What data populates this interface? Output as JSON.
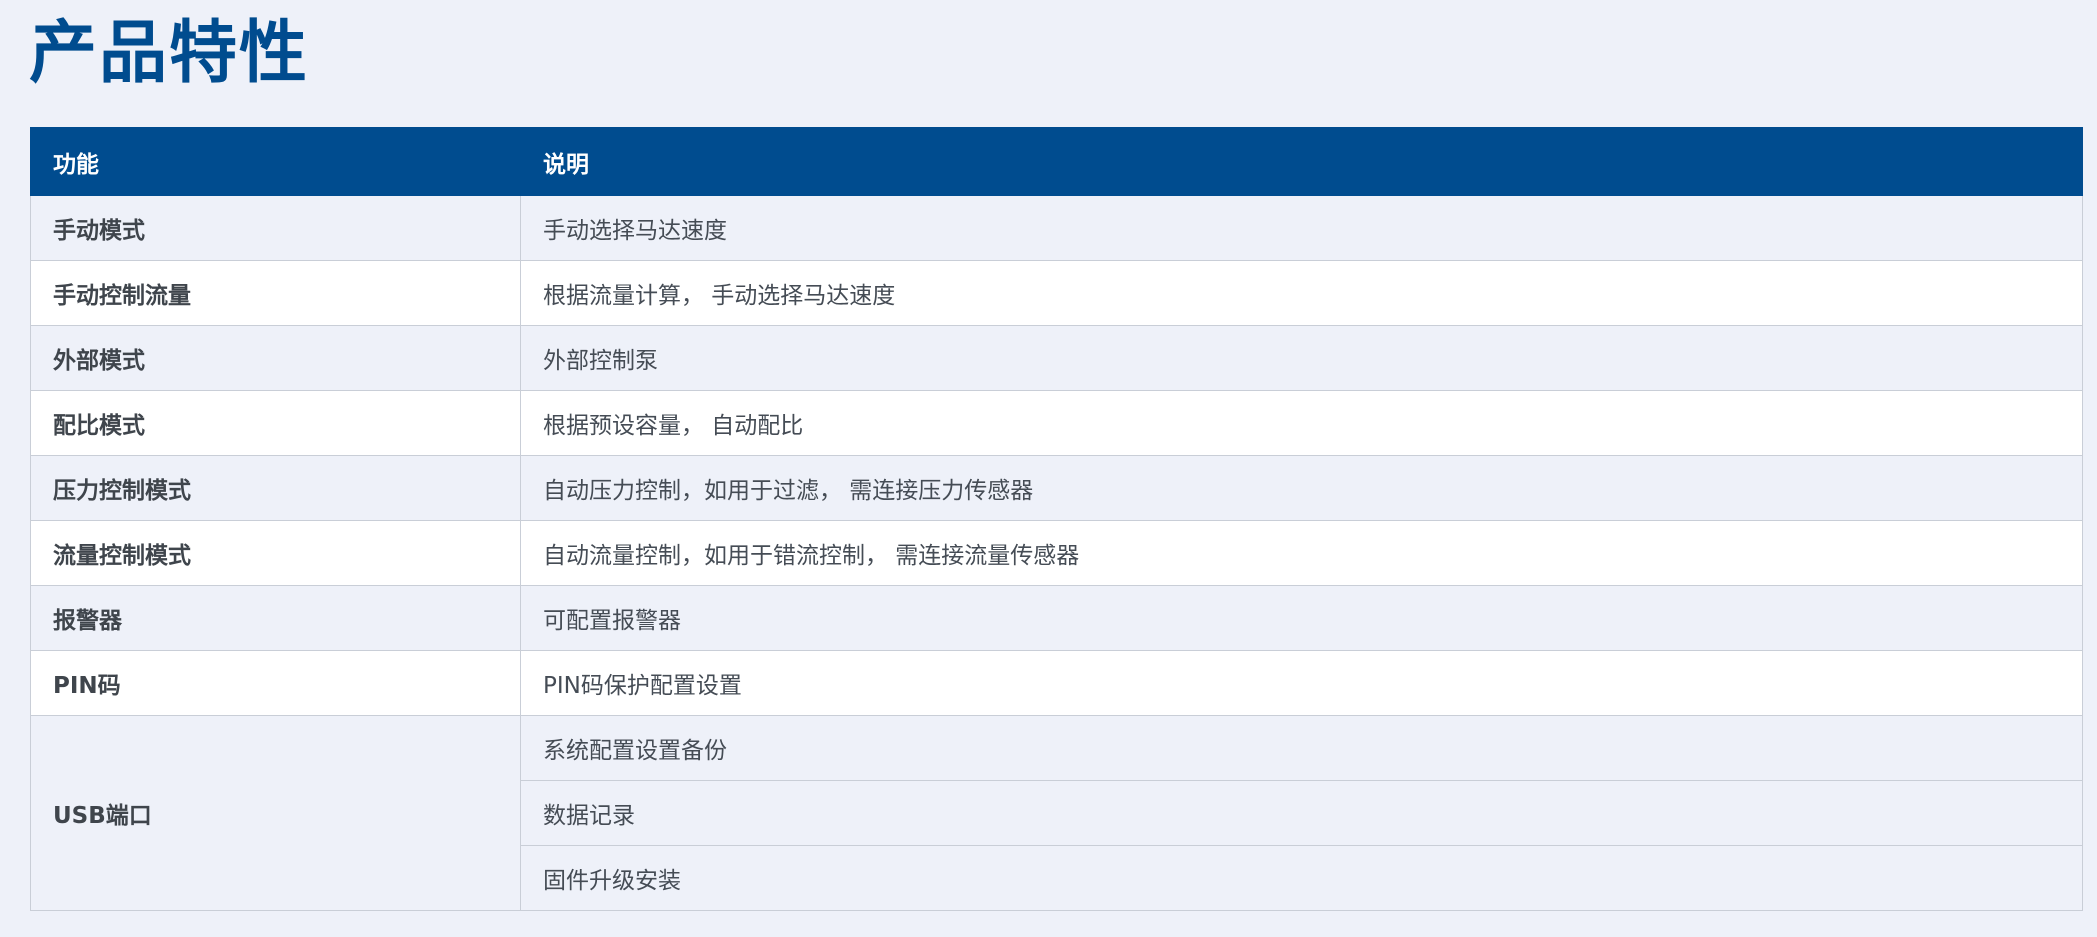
{
  "title": "产品特性",
  "table": {
    "headers": {
      "feature": "功能",
      "description": "说明"
    },
    "rows": [
      {
        "feature": "手动模式",
        "description": "手动选择马达速度"
      },
      {
        "feature": "手动控制流量",
        "description": "根据流量计算， 手动选择马达速度"
      },
      {
        "feature": "外部模式",
        "description": "外部控制泵"
      },
      {
        "feature": "配比模式",
        "description": "根据预设容量， 自动配比"
      },
      {
        "feature": "压力控制模式",
        "description": "自动压力控制，如用于过滤， 需连接压力传感器"
      },
      {
        "feature": "流量控制模式",
        "description": "自动流量控制，如用于错流控制， 需连接流量传感器"
      },
      {
        "feature": "报警器",
        "description": "可配置报警器"
      },
      {
        "feature": "PIN码",
        "description": "PIN码保护配置设置"
      }
    ],
    "usb": {
      "feature": "USB端口",
      "descriptions": [
        "系统配置设置备份",
        "数据记录",
        "固件升级安装"
      ]
    }
  }
}
